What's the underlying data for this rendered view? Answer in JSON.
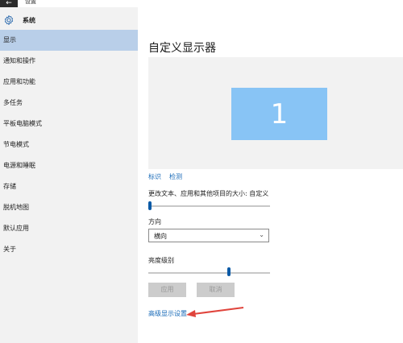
{
  "window": {
    "title": "设置",
    "back_glyph": "←"
  },
  "sidebar": {
    "header": {
      "label": "系统",
      "icon": "gear-icon"
    },
    "items": [
      {
        "label": "显示",
        "active": true
      },
      {
        "label": "通知和操作",
        "active": false
      },
      {
        "label": "应用和功能",
        "active": false
      },
      {
        "label": "多任务",
        "active": false
      },
      {
        "label": "平板电脑模式",
        "active": false
      },
      {
        "label": "节电模式",
        "active": false
      },
      {
        "label": "电源和睡眠",
        "active": false
      },
      {
        "label": "存储",
        "active": false
      },
      {
        "label": "脱机地图",
        "active": false
      },
      {
        "label": "默认应用",
        "active": false
      },
      {
        "label": "关于",
        "active": false
      }
    ]
  },
  "main": {
    "title": "自定义显示器",
    "monitor_number": "1",
    "identify_link": "标识",
    "detect_link": "检测",
    "scale_label": "更改文本、应用和其他项目的大小: 自定义",
    "scale_level": 0.0,
    "orientation_label": "方向",
    "orientation_value": "横向",
    "brightness_label": "亮度级别",
    "brightness_level": 0.67,
    "apply_button": "应用",
    "cancel_button": "取消",
    "advanced_link": "高级显示设置"
  },
  "colors": {
    "accent": "#0b5aa6",
    "link": "#1a6bb8",
    "active_nav": "#b9cfe9",
    "monitor": "#88c4f5",
    "annotation_arrow": "#e0443c"
  }
}
